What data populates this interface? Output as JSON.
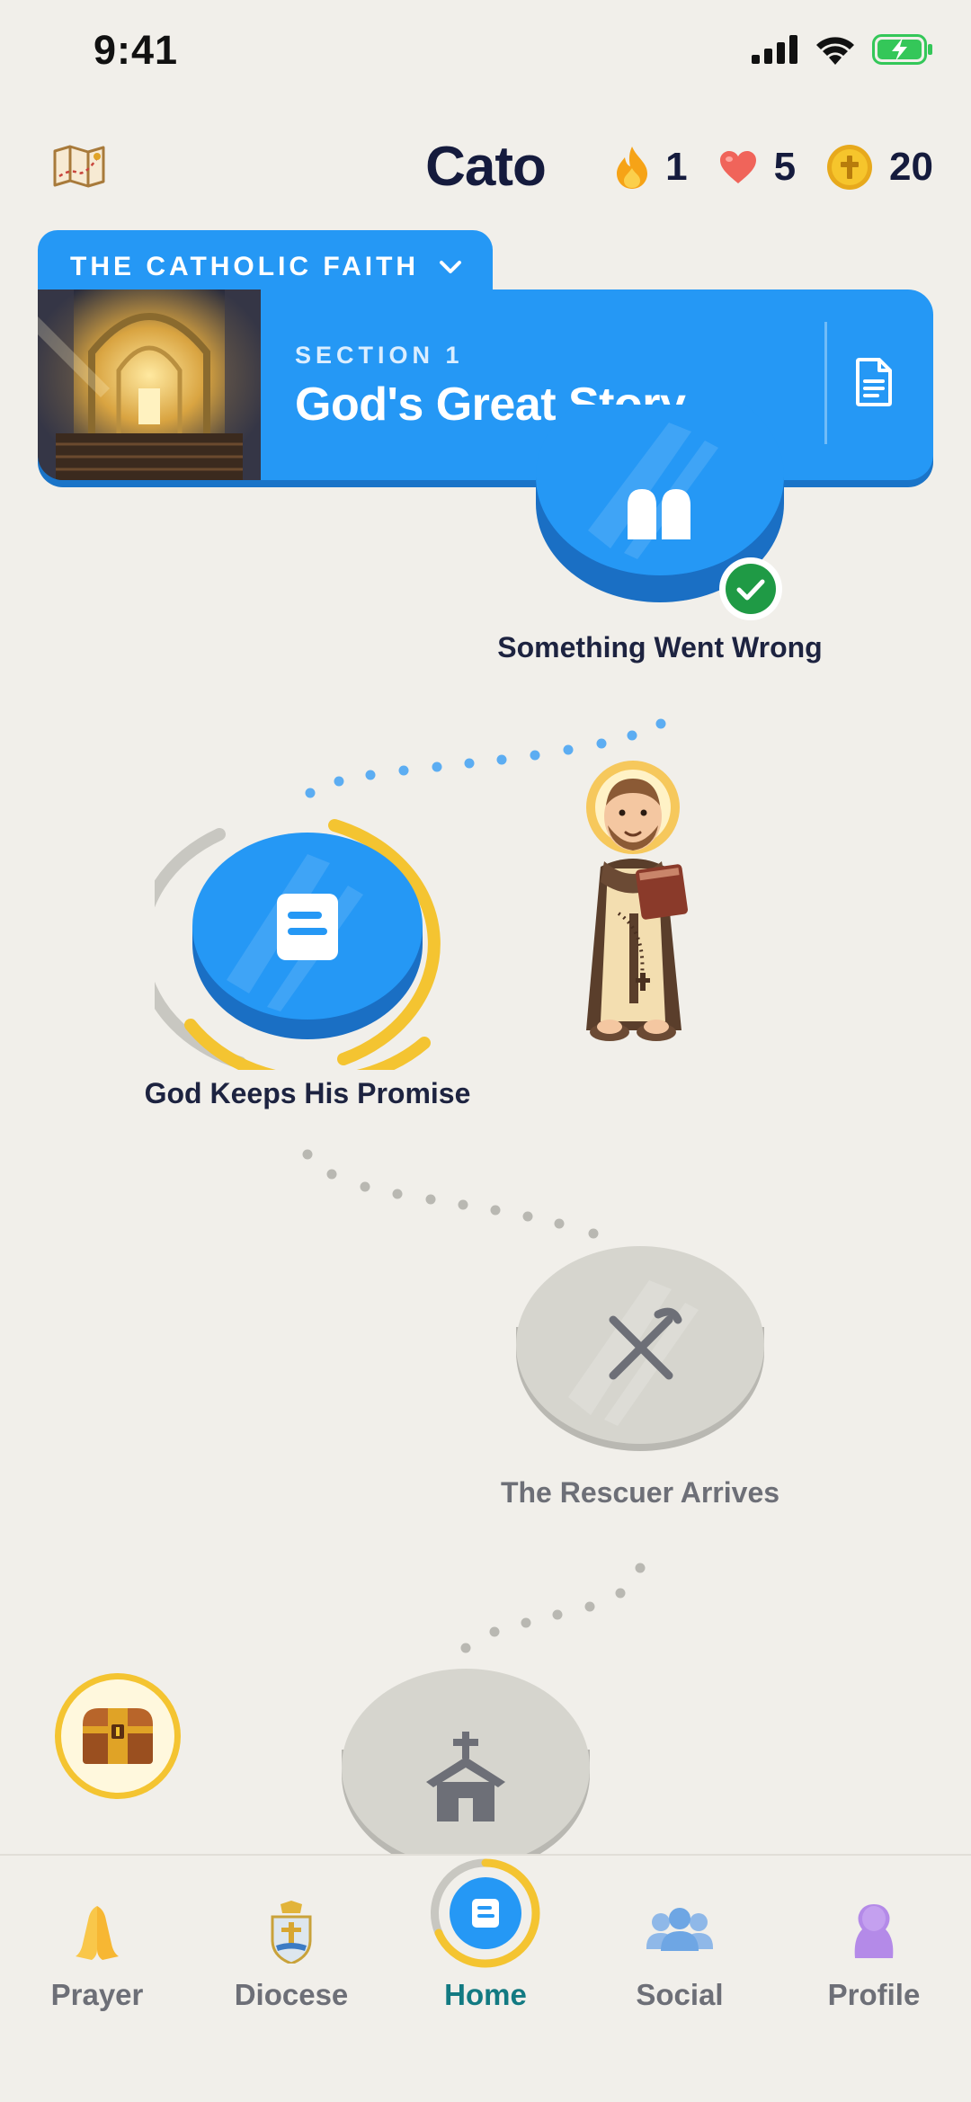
{
  "status_bar": {
    "time": "9:41"
  },
  "header": {
    "app_title": "Cato",
    "streak": "1",
    "hearts": "5",
    "coins": "20"
  },
  "section": {
    "course_name": "THE CATHOLIC FAITH",
    "label": "SECTION 1",
    "title": "God's Great Story"
  },
  "lessons": [
    {
      "title": "Something Went Wrong",
      "state": "completed"
    },
    {
      "title": "God Keeps His Promise",
      "state": "current"
    },
    {
      "title": "The Rescuer Arrives",
      "state": "locked"
    },
    {
      "title": "",
      "state": "locked"
    }
  ],
  "bottom_nav": {
    "items": [
      {
        "label": "Prayer",
        "icon": "praying-hands-icon",
        "active": false
      },
      {
        "label": "Diocese",
        "icon": "diocese-crest-icon",
        "active": false
      },
      {
        "label": "Home",
        "icon": "home-lesson-icon",
        "active": true
      },
      {
        "label": "Social",
        "icon": "people-icon",
        "active": false
      },
      {
        "label": "Profile",
        "icon": "person-icon",
        "active": false
      }
    ]
  },
  "colors": {
    "primary_blue": "#2598f5",
    "gold": "#f4c431",
    "success_green": "#1f9a45",
    "locked_gray": "#d6d5ce",
    "active_nav": "#127a82"
  }
}
